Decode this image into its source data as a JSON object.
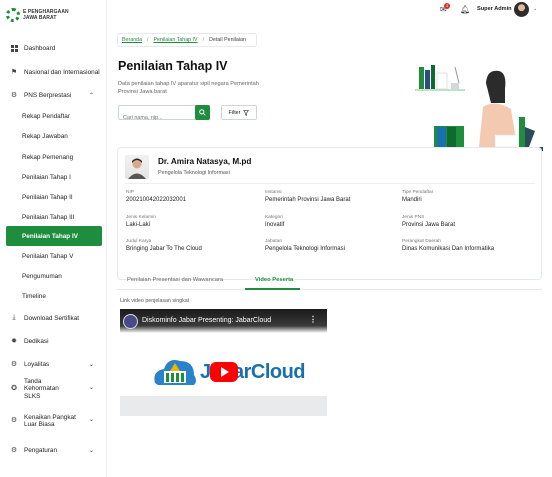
{
  "app": {
    "logo_text_line1": "E PENGHARGAAN",
    "logo_text_line2": "JAWA BARAT"
  },
  "sidebar": {
    "items": [
      {
        "label": "Dashboard",
        "icon": "grid-icon"
      },
      {
        "label": "Nasional dan Internasional",
        "icon": "flag-icon"
      },
      {
        "label": "PNS Berprestasi",
        "icon": "gear-icon",
        "expanded": true
      },
      {
        "label": "Rekap Pendaftar"
      },
      {
        "label": "Rekap Jawaban"
      },
      {
        "label": "Rekap Pemenang"
      },
      {
        "label": "Penilaian Tahap I"
      },
      {
        "label": "Penilaian Tahap II"
      },
      {
        "label": "Penilaian Tahap III"
      },
      {
        "label": "Penilaian Tahap IV",
        "active": true
      },
      {
        "label": "Penilaian Tahap V"
      },
      {
        "label": "Pengumuman"
      },
      {
        "label": "Timeline"
      },
      {
        "label": "Download Sertifikat",
        "icon": "download-icon"
      },
      {
        "label": "Dedikasi",
        "icon": "sun-icon"
      },
      {
        "label": "Loyalitas",
        "icon": "gear-icon"
      },
      {
        "label": "Tanda Kehormatan SLKS",
        "icon": "medal-icon"
      },
      {
        "label": "Kenaikan Pangkat Luar Biasa",
        "icon": "gear-icon"
      },
      {
        "label": "Pengaturan",
        "icon": "gear-icon"
      }
    ]
  },
  "topbar": {
    "notification_count": "3",
    "user_name": "Super Admin"
  },
  "breadcrumb": {
    "home": "Beranda",
    "parent": "Penilaian Tahap IV",
    "current": "Detail Penilaian"
  },
  "page": {
    "title": "Penilaian Tahap IV",
    "description": "Data penilaian tahap IV aparatur sipil negara Pemerintah Provinsi Jawa barat",
    "search_placeholder": "Cari nama, nip...",
    "filter_label": "Filter"
  },
  "profile": {
    "name": "Dr. Amira Natasya, M.pd",
    "role": "Pengelola Teknologi Informasi",
    "fields": [
      {
        "label": "NIP",
        "value": "200210042022032001"
      },
      {
        "label": "Instansi",
        "value": "Pemerintah Provinsi Jawa Barat"
      },
      {
        "label": "Tipe Pendaftar",
        "value": "Mandiri"
      },
      {
        "label": "Jenis Kelamin",
        "value": "Laki-Laki"
      },
      {
        "label": "Kategori",
        "value": "Inovatif"
      },
      {
        "label": "Jenis PNS",
        "value": "Provinsi Jawa Barat"
      },
      {
        "label": "Judul Karya",
        "value": "Bringing Jabar To The Cloud"
      },
      {
        "label": "Jabatan",
        "value": "Pengelola Teknologi Informasi"
      },
      {
        "label": "Perangkat Daerah",
        "value": "Dinas Komunikasi Dan Informatika"
      }
    ]
  },
  "tabs": [
    {
      "label": "Penilaian Presentasi dan Wawancara"
    },
    {
      "label": "Video Peserta",
      "active": true
    }
  ],
  "video": {
    "caption": "Link video penjelasan singkat",
    "title": "Diskominfo Jabar Presenting: JabarCloud",
    "brand_text": "JabarCloud"
  },
  "colors": {
    "primary": "#1e8e3e",
    "notification": "#d93025",
    "youtube_red": "#ff0000",
    "brand_blue": "#1a6fb0"
  }
}
